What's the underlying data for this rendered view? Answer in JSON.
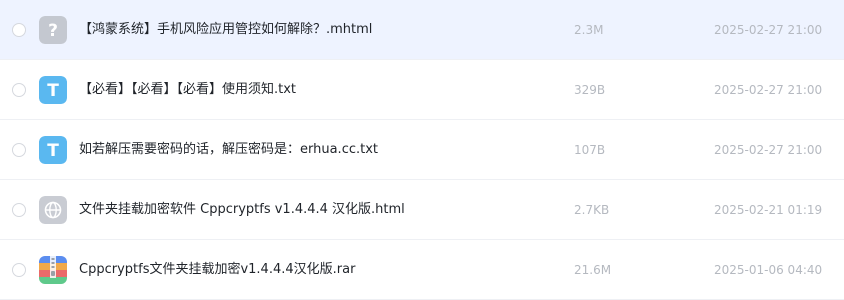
{
  "files": [
    {
      "name": "【鸿蒙系统】手机风险应用管控如何解除？.mhtml",
      "size": "2.3M",
      "date": "2025-02-27 21:00",
      "icon": "unknown-file-icon",
      "selected": true
    },
    {
      "name": "【必看】【必看】【必看】使用须知.txt",
      "size": "329B",
      "date": "2025-02-27 21:00",
      "icon": "text-file-icon",
      "selected": false
    },
    {
      "name": "如若解压需要密码的话，解压密码是：erhua.cc.txt",
      "size": "107B",
      "date": "2025-02-27 21:00",
      "icon": "text-file-icon",
      "selected": false
    },
    {
      "name": "文件夹挂载加密软件 Cppcryptfs v1.4.4.4 汉化版.html",
      "size": "2.7KB",
      "date": "2025-02-21 01:19",
      "icon": "web-file-icon",
      "selected": false
    },
    {
      "name": "Cppcryptfs文件夹挂载加密v1.4.4.4汉化版.rar",
      "size": "21.6M",
      "date": "2025-01-06 04:40",
      "icon": "archive-file-icon",
      "selected": false
    }
  ],
  "icon_glyphs": {
    "unknown-file-icon": "?",
    "text-file-icon": "T"
  },
  "colors": {
    "selected_row": "#eef3ff",
    "text_icon": "#5ab8f0",
    "unknown_icon": "#c4c8d0",
    "web_icon": "#c9ccd3"
  }
}
